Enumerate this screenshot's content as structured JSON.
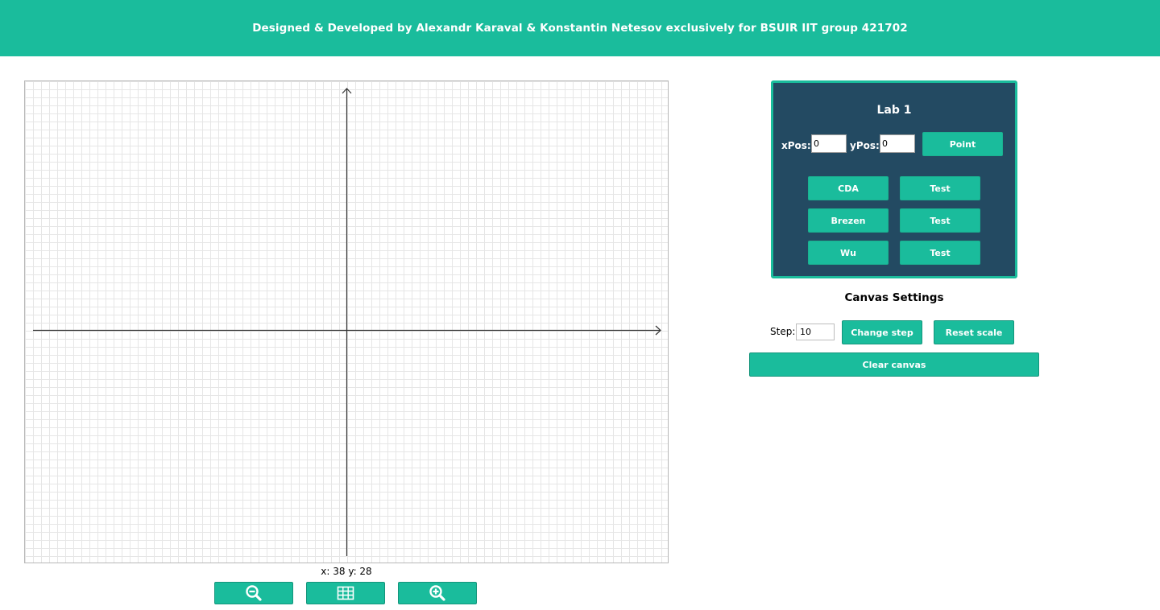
{
  "header": {
    "title": "Designed & Developed by Alexandr Karaval & Konstantin Netesov exclusively for BSUIR IIT group 421702"
  },
  "canvas": {
    "coords_text": "x: 38 y: 28",
    "toolbar": {
      "zoom_out_icon": "zoom-out-icon",
      "grid_icon": "grid-icon",
      "zoom_in_icon": "zoom-in-icon"
    }
  },
  "lab_panel": {
    "title": "Lab 1",
    "xpos_label": "xPos:",
    "xpos_value": "0",
    "ypos_label": "yPos:",
    "ypos_value": "0",
    "point_button": "Point",
    "algorithms": [
      {
        "label": "CDA",
        "test_label": "Test"
      },
      {
        "label": "Brezen",
        "test_label": "Test"
      },
      {
        "label": "Wu",
        "test_label": "Test"
      }
    ]
  },
  "canvas_settings": {
    "title": "Canvas Settings",
    "step_label": "Step:",
    "step_value": "10",
    "change_step_button": "Change step",
    "reset_scale_button": "Reset scale",
    "clear_canvas_button": "Clear canvas"
  },
  "colors": {
    "accent": "#1abc9c",
    "panel_bg": "#234a62",
    "grid_line": "#e6e6e6",
    "axis": "#333333"
  }
}
